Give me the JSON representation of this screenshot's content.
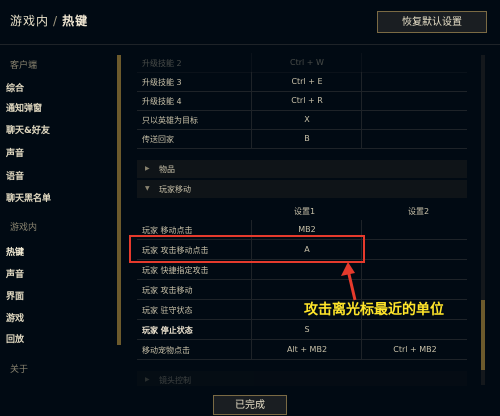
{
  "header": {
    "breadcrumb_parent": "游戏内",
    "breadcrumb_sep": "/",
    "breadcrumb_current": "热键",
    "reset_button": "恢复默认设置"
  },
  "sidebar": {
    "client_label": "客户端",
    "client_items": [
      "综合",
      "通知弹窗",
      "聊天&好友",
      "声音",
      "语音",
      "聊天黑名单"
    ],
    "ingame_label": "游戏内",
    "ingame_items": [
      "热键",
      "声音",
      "界面",
      "游戏",
      "回放"
    ],
    "about_label": "关于",
    "about_items": [
      "验证"
    ]
  },
  "table": {
    "top_rows": [
      {
        "label": "升级技能 2",
        "key1": "Ctrl + W",
        "key2": ""
      },
      {
        "label": "升级技能 3",
        "key1": "Ctrl + E",
        "key2": ""
      },
      {
        "label": "升级技能 4",
        "key1": "Ctrl + R",
        "key2": ""
      },
      {
        "label": "只以英雄为目标",
        "key1": "X",
        "key2": ""
      },
      {
        "label": "传送回家",
        "key1": "B",
        "key2": ""
      }
    ],
    "section_items": "物品",
    "section_move": "玩家移动",
    "col1": "设置1",
    "col2": "设置2",
    "move_rows": [
      {
        "label": "玩家 移动点击",
        "key1": "MB2",
        "key2": ""
      },
      {
        "label": "玩家 攻击移动点击",
        "key1": "A",
        "key2": ""
      },
      {
        "label": "玩家 快捷指定攻击",
        "key1": "",
        "key2": ""
      },
      {
        "label": "玩家 攻击移动",
        "key1": "",
        "key2": ""
      },
      {
        "label": "玩家 驻守状态",
        "key1": "",
        "key2": ""
      },
      {
        "label": "玩家 停止状态",
        "key1": "S",
        "key2": ""
      },
      {
        "label": "移动宠物点击",
        "key1": "Alt + MB2",
        "key2": "Ctrl + MB2"
      }
    ],
    "section_next": "镜头控制"
  },
  "annotation": "攻击离光标最近的单位",
  "footer": {
    "done_button": "已完成"
  },
  "colors": {
    "accent_gold": "#6c5a2c",
    "highlight_red": "#e53a2c",
    "annotation_yellow": "#ffe52a"
  }
}
